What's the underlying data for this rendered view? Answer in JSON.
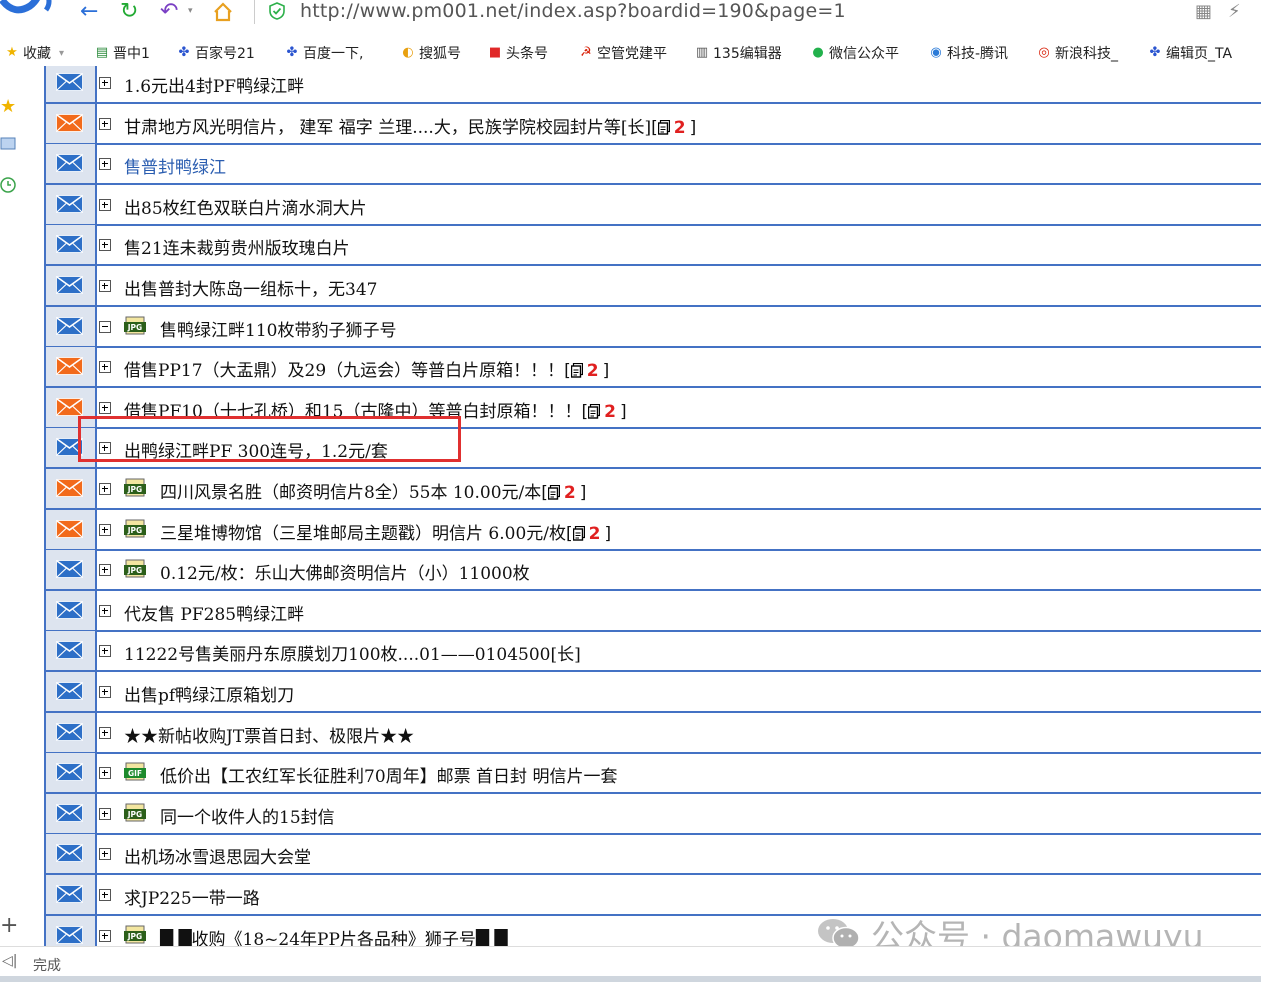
{
  "address_bar": {
    "url": "http://www.pm001.net/index.asp?boardid=190&page=1"
  },
  "bookmarks": [
    {
      "label": "收藏",
      "icon": "star-icon"
    },
    {
      "label": "晋中1",
      "icon": "bookmark-icon"
    },
    {
      "label": "百家号21",
      "icon": "baidu-paw-icon"
    },
    {
      "label": "百度一下,",
      "icon": "baidu-paw-icon"
    },
    {
      "label": "搜狐号",
      "icon": "sohu-icon"
    },
    {
      "label": "头条号",
      "icon": "toutiao-icon"
    },
    {
      "label": "空管党建平",
      "icon": "party-icon"
    },
    {
      "label": "135编辑器",
      "icon": "editor-icon"
    },
    {
      "label": "微信公众平",
      "icon": "wechat-icon"
    },
    {
      "label": "科技-腾讯",
      "icon": "tencent-icon"
    },
    {
      "label": "新浪科技_",
      "icon": "sina-icon"
    },
    {
      "label": "编辑页_TA",
      "icon": "baidu-paw-icon"
    }
  ],
  "posts": [
    {
      "mail": "blue",
      "expander": "plus",
      "file": "",
      "title": "1.6元出4封PF鸭绿江畔",
      "replies": "",
      "link": false
    },
    {
      "mail": "orange",
      "expander": "plus",
      "file": "",
      "title": "甘肃地方风光明信片， 建军 福字 兰理....大，民族学院校园封片等[长]",
      "replies": "2",
      "link": false
    },
    {
      "mail": "blue",
      "expander": "plus",
      "file": "",
      "title": "售普封鸭绿江",
      "replies": "",
      "link": true
    },
    {
      "mail": "blue",
      "expander": "plus",
      "file": "",
      "title": "出85枚红色双联白片滴水洞大片",
      "replies": "",
      "link": false
    },
    {
      "mail": "blue",
      "expander": "plus",
      "file": "",
      "title": "售21连未裁剪贵州版玫瑰白片",
      "replies": "",
      "link": false
    },
    {
      "mail": "blue",
      "expander": "plus",
      "file": "",
      "title": "出售普封大陈岛一组标十，无347",
      "replies": "",
      "link": false
    },
    {
      "mail": "blue",
      "expander": "minus",
      "file": "JPG",
      "title": "售鸭绿江畔110枚带豹子狮子号",
      "replies": "",
      "link": false
    },
    {
      "mail": "orange",
      "expander": "plus",
      "file": "",
      "title": "借售PP17（大盂鼎）及29（九运会）等普白片原箱！！！",
      "replies": "2",
      "link": false
    },
    {
      "mail": "orange",
      "expander": "plus",
      "file": "",
      "title": "借售PF10（十七孔桥）和15（古隆中）等普白封原箱！！！",
      "replies": "2",
      "link": false
    },
    {
      "mail": "blue",
      "expander": "plus",
      "file": "",
      "title": "出鸭绿江畔PF 300连号，1.2元/套",
      "replies": "",
      "link": false
    },
    {
      "mail": "orange",
      "expander": "plus",
      "file": "JPG",
      "title": "四川风景名胜（邮资明信片8全）55本 10.00元/本",
      "replies": "2",
      "link": false
    },
    {
      "mail": "orange",
      "expander": "plus",
      "file": "JPG",
      "title": "三星堆博物馆（三星堆邮局主题戳）明信片 6.00元/枚",
      "replies": "2",
      "link": false
    },
    {
      "mail": "blue",
      "expander": "plus",
      "file": "JPG",
      "title": "0.12元/枚：乐山大佛邮资明信片（小）11000枚",
      "replies": "",
      "link": false
    },
    {
      "mail": "blue",
      "expander": "plus",
      "file": "",
      "title": "代友售 PF285鸭绿江畔",
      "replies": "",
      "link": false
    },
    {
      "mail": "blue",
      "expander": "plus",
      "file": "",
      "title": "11222号售美丽丹东原膜划刀100枚....01——0104500[长]",
      "replies": "",
      "link": false
    },
    {
      "mail": "blue",
      "expander": "plus",
      "file": "",
      "title": "出售pf鸭绿江原箱划刀",
      "replies": "",
      "link": false
    },
    {
      "mail": "blue",
      "expander": "plus",
      "file": "",
      "title": "★★新帖收购JT票首日封、极限片★★",
      "replies": "",
      "link": false
    },
    {
      "mail": "blue",
      "expander": "plus",
      "file": "GIF",
      "title": "低价出【工农红军长征胜利70周年】邮票 首日封 明信片一套",
      "replies": "",
      "link": false
    },
    {
      "mail": "blue",
      "expander": "plus",
      "file": "JPG",
      "title": "同一个收件人的15封信",
      "replies": "",
      "link": false
    },
    {
      "mail": "blue",
      "expander": "plus",
      "file": "",
      "title": "出机场冰雪退思园大会堂",
      "replies": "",
      "link": false
    },
    {
      "mail": "blue",
      "expander": "plus",
      "file": "",
      "title": "求JP225一带一路",
      "replies": "",
      "link": false
    },
    {
      "mail": "blue",
      "expander": "plus",
      "file": "JPG",
      "title": "█ █收购《18~24年PP片各品种》狮子号█ █",
      "replies": "",
      "link": false
    }
  ],
  "status": {
    "text": "完成"
  },
  "watermark": {
    "text": "公众号 · daomawuyu"
  },
  "colors": {
    "row_border": "#4472c4",
    "left_cell": "#dde4ef",
    "highlight": "#e03030",
    "reply_count": "#e02020"
  }
}
